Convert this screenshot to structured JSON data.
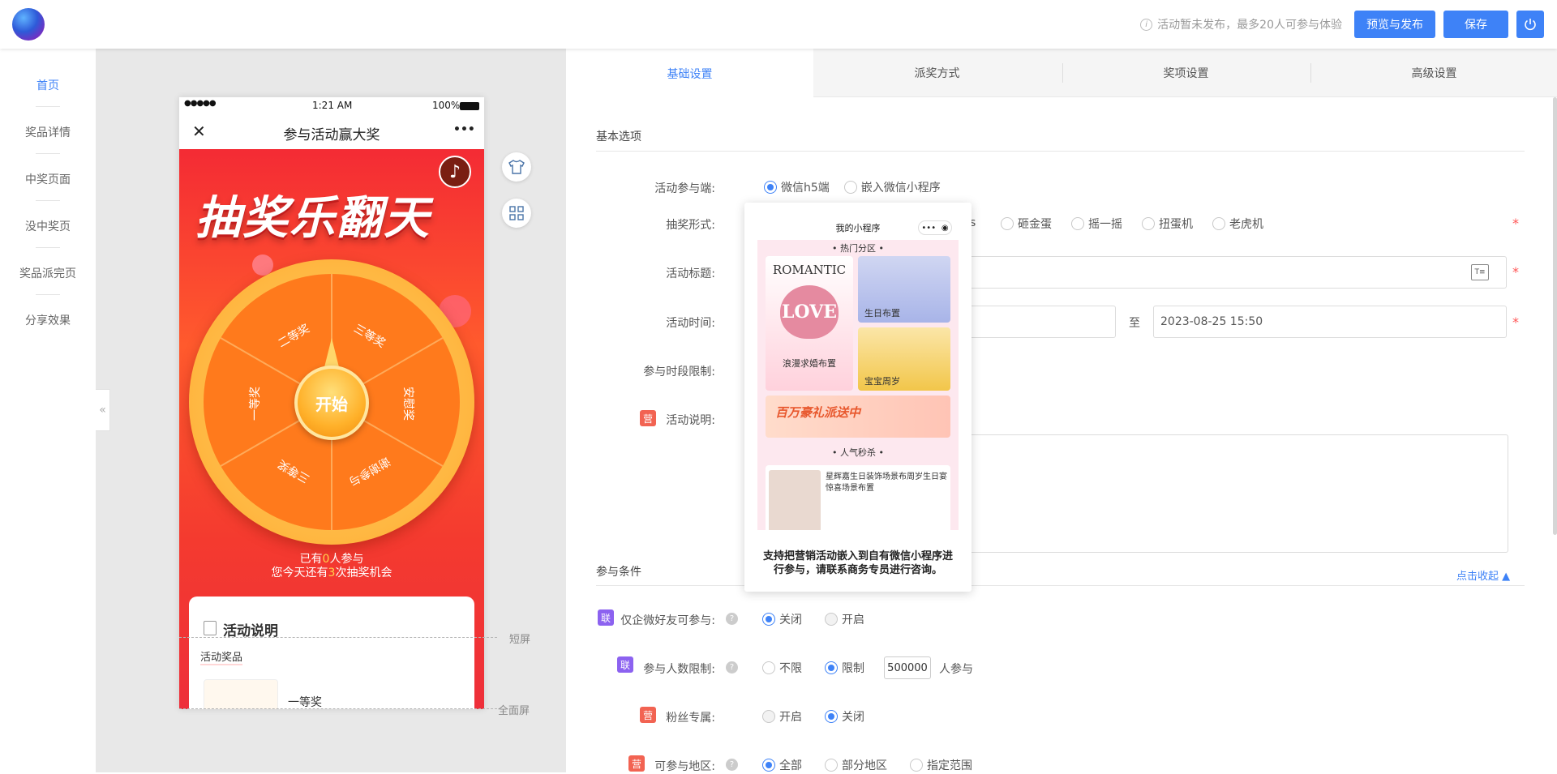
{
  "topbar": {
    "notice": "活动暂未发布，最多20人可参与体验",
    "info_icon": "info-icon",
    "publish_label": "预览与发布",
    "save_label": "保存",
    "power_icon": "power-icon",
    "accent": "#3e82f7"
  },
  "nav": {
    "items": [
      "首页",
      "奖品详情",
      "中奖页面",
      "没中奖页",
      "奖品派完页",
      "分享效果"
    ],
    "collapse": "«"
  },
  "phone": {
    "signal": "●●●●●",
    "time": "1:21 AM",
    "battery": "100%",
    "title": "参与活动赢大奖",
    "close": "✕",
    "more": "•••",
    "headline": "抽奖乐翻天",
    "music_icon": "♪",
    "prizes": [
      "二等奖",
      "三等奖",
      "安慰奖",
      "谢谢参与",
      "三等奖",
      "一等奖"
    ],
    "start": "开始",
    "join_line1_a": "已有",
    "join_count": "0",
    "join_line1_b": "人参与",
    "join_line2_a": "您今天还有",
    "join_chances": "3",
    "join_line2_b": "次抽奖机会",
    "card_title": "活动说明",
    "card_tag": "活动奖品",
    "prize_name": "一等奖",
    "short_screen": "短屏",
    "full_screen": "全面屏"
  },
  "tabs": [
    "基础设置",
    "派奖方式",
    "奖项设置",
    "高级设置"
  ],
  "basic": {
    "section": "基本选项",
    "platform_label": "活动参与端:",
    "platform_options": [
      "微信h5端",
      "嵌入微信小程序"
    ],
    "form_label": "抽奖形式:",
    "form_options": [
      "砸金蛋",
      "摇一摇",
      "扭蛋机",
      "老虎机"
    ],
    "form_partial": "s",
    "title_label": "活动标题:",
    "time_label": "活动时间:",
    "time_to": "至",
    "end_time": "2023-08-25 15:50",
    "period_label": "参与时段限制:",
    "desc_label": "活动说明:",
    "badge_ying": "营"
  },
  "conditions": {
    "section": "参与条件",
    "fold": "点击收起",
    "wecom_label": "仅企微好友可参与:",
    "badge_lian": "联",
    "off": "关闭",
    "on": "开启",
    "people_label": "参与人数限制:",
    "unlimited": "不限",
    "limited": "限制",
    "people_value": "500000",
    "people_unit": "人参与",
    "fans_label": "粉丝专属:",
    "region_label": "可参与地区:",
    "region_options": [
      "全部",
      "部分地区",
      "指定范围"
    ],
    "help": "?"
  },
  "popover": {
    "title": "我的小程序",
    "hot": "• 热门分区 •",
    "romantic": "ROMANTIC",
    "love": "LOVE",
    "romantic_caption": "浪漫求婚布置",
    "birthday_caption": "生日布置",
    "baby_caption": "宝宝周岁",
    "banner": "百万豪礼派送中",
    "popular": "• 人气秒杀 •",
    "item_text": "星辉嘉生日装饰场景布周岁生日宴惊喜场景布置",
    "message": "支持把营销活动嵌入到自有微信小程序进行参与，请联系商务专员进行咨询。"
  }
}
